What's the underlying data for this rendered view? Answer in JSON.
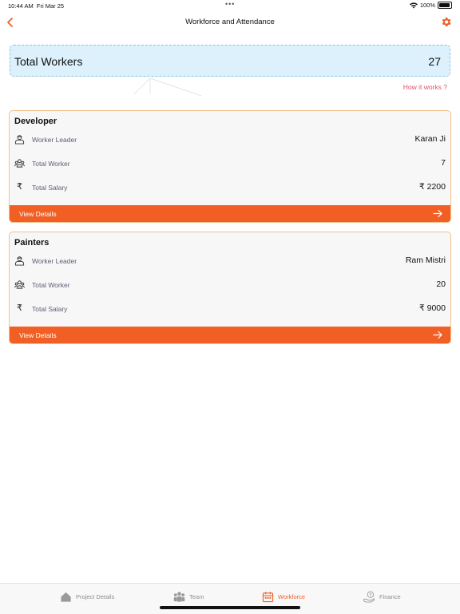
{
  "status_bar": {
    "time": "10:44 AM",
    "date": "Fri Mar 25",
    "battery": "100%"
  },
  "nav": {
    "title": "Workforce and Attendance",
    "back_icon": "chevron-left-icon",
    "settings_icon": "gear-icon"
  },
  "summary": {
    "label": "Total Workers",
    "value": "27"
  },
  "help_link": "How it works ?",
  "teams": [
    {
      "name": "Developer",
      "leader_label": "Worker Leader",
      "leader": "Karan Ji",
      "workers_label": "Total Worker",
      "workers": "7",
      "salary_label": "Total Salary",
      "salary": "₹ 2200",
      "action": "View Details"
    },
    {
      "name": "Painters",
      "leader_label": "Worker Leader",
      "leader": "Ram Mistri",
      "workers_label": "Total Worker",
      "workers": "20",
      "salary_label": "Total Salary",
      "salary": "₹ 9000",
      "action": "View Details"
    }
  ],
  "tabbar": {
    "items": [
      {
        "label": "Project Details",
        "icon": "home-icon"
      },
      {
        "label": "Team",
        "icon": "team-icon"
      },
      {
        "label": "Workforce",
        "icon": "calendar-icon",
        "active": true
      },
      {
        "label": "Finance",
        "icon": "finance-icon"
      }
    ]
  },
  "colors": {
    "accent": "#f15f25",
    "summary_bg": "#dcf1fb",
    "link": "#e0536b",
    "card_border": "#f3c08a"
  }
}
